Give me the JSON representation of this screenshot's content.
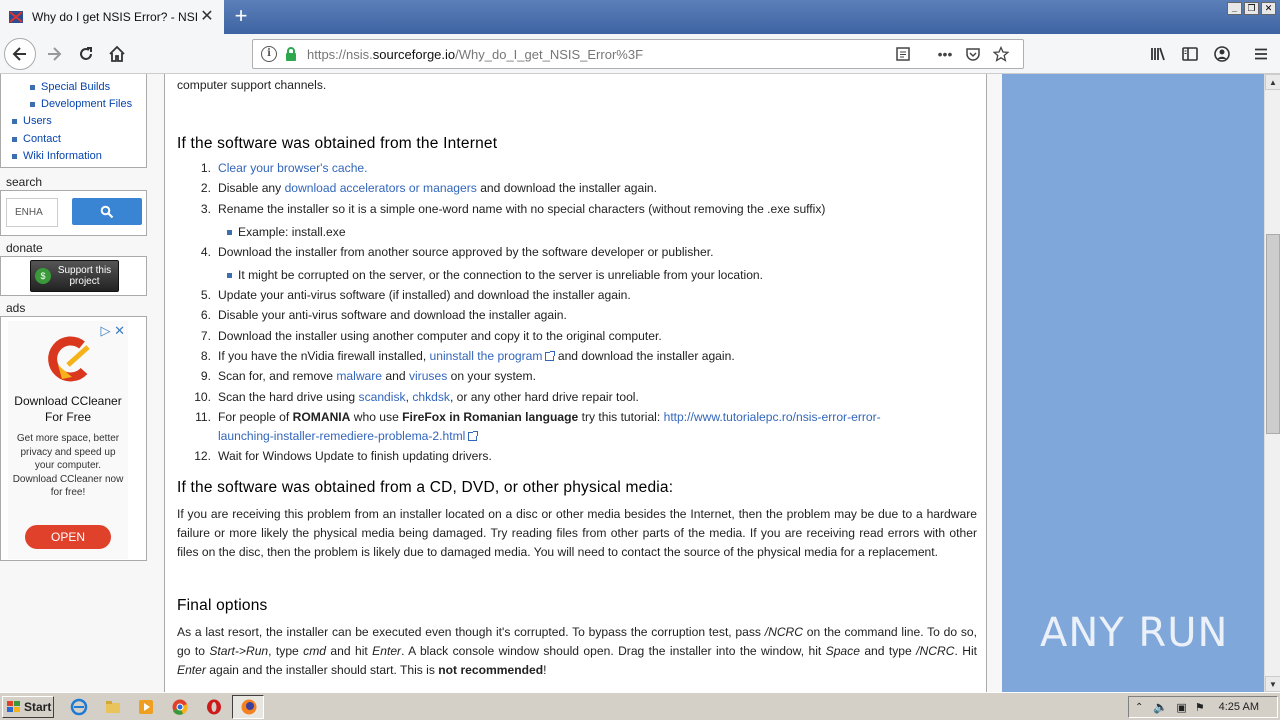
{
  "browser": {
    "tab_title": "Why do I get NSIS Error? - NSIS",
    "url_prefix": "https://nsis.",
    "url_domain": "sourceforge.io",
    "url_path": "/Why_do_I_get_NSIS_Error%3F",
    "page_actions_label": "•••"
  },
  "sidebar": {
    "nav_items": [
      "Special Builds",
      "Development Files",
      "Users",
      "Contact",
      "Wiki Information"
    ],
    "search_heading": "search",
    "search_placeholder": "ENHA",
    "donate_heading": "donate",
    "donate_label": "Support this project",
    "ads_heading": "ads",
    "ad": {
      "title": "Download CCleaner For Free",
      "description": "Get more space, better privacy and speed up your computer. Download CCleaner now for free!",
      "button": "OPEN"
    }
  },
  "content": {
    "intro_tail": "computer support channels.",
    "section1_title": "If the software was obtained from the Internet",
    "steps": [
      {
        "n": "1.",
        "pre": "",
        "link": "Clear your browser's cache.",
        "post": ""
      },
      {
        "n": "2.",
        "pre": "Disable any ",
        "link": "download accelerators or managers",
        "post": " and download the installer again."
      },
      {
        "n": "3.",
        "pre": "Rename the installer so it is a simple one-word name with no special characters (without removing the .exe suffix)",
        "link": "",
        "post": ""
      },
      {
        "n": "4.",
        "pre": "Download the installer from another source approved by the software developer or publisher.",
        "link": "",
        "post": ""
      },
      {
        "n": "5.",
        "pre": "Update your anti-virus software (if installed) and download the installer again.",
        "link": "",
        "post": ""
      },
      {
        "n": "6.",
        "pre": "Disable your anti-virus software and download the installer again.",
        "link": "",
        "post": ""
      },
      {
        "n": "7.",
        "pre": "Download the installer using another computer and copy it to the original computer.",
        "link": "",
        "post": ""
      },
      {
        "n": "8.",
        "pre": "If you have the nVidia firewall installed, ",
        "link": "uninstall the program",
        "post": " and download the installer again."
      },
      {
        "n": "9.",
        "pre": "Scan for, and remove ",
        "link": "malware",
        "mid": " and ",
        "link2": "viruses",
        "post": " on your system."
      },
      {
        "n": "10.",
        "pre": "Scan the hard drive using ",
        "link": "scandisk",
        "mid": ", ",
        "link2": "chkdsk",
        "post": ", or any other hard drive repair tool."
      },
      {
        "n": "11.",
        "pre": "For people of ",
        "bold1": "ROMANIA",
        "mid": " who use ",
        "bold2": "FireFox in Romanian language",
        "post": " try this tutorial: ",
        "link": "http://www.tutorialepc.ro/nsis-error-error-",
        "link_line2": "launching-installer-remediere-problema-2.html"
      },
      {
        "n": "12.",
        "pre": "Wait for Windows Update to finish updating drivers.",
        "link": "",
        "post": ""
      }
    ],
    "sub3": "Example: install.exe",
    "sub4": "It might be corrupted on the server, or the connection to the server is unreliable from your location.",
    "section2_title": "If the software was obtained from a CD, DVD, or other physical media:",
    "section2_body": "If you are receiving this problem from an installer located on a disc or other media besides the Internet, then the problem may be due to a hardware failure or more likely the physical media being damaged. Try reading files from other parts of the media. If you are receiving read errors with other files on the disc, then the problem is likely due to damaged media. You will need to contact the source of the physical media for a replacement.",
    "section3_title": "Final options",
    "final": {
      "t1": "As a last resort, the installer can be executed even though it's corrupted. To bypass the corruption test, pass ",
      "i1": "/NCRC",
      "t2": " on the command line. To do so, go to ",
      "i2": "Start->Run",
      "t3": ", type ",
      "i3": "cmd",
      "t4": " and hit ",
      "i4": "Enter",
      "t5": ". A black console window should open. Drag the installer into the window, hit ",
      "i5": "Space",
      "t6": " and type ",
      "i6": "/NCRC",
      "t7": ". Hit ",
      "i7": "Enter",
      "t8": " again and the installer should start. This is ",
      "b1": "not recommended",
      "t9": "!"
    }
  },
  "watermark": "ANY RUN",
  "taskbar": {
    "start_label": "Start",
    "clock": "4:25 AM"
  }
}
